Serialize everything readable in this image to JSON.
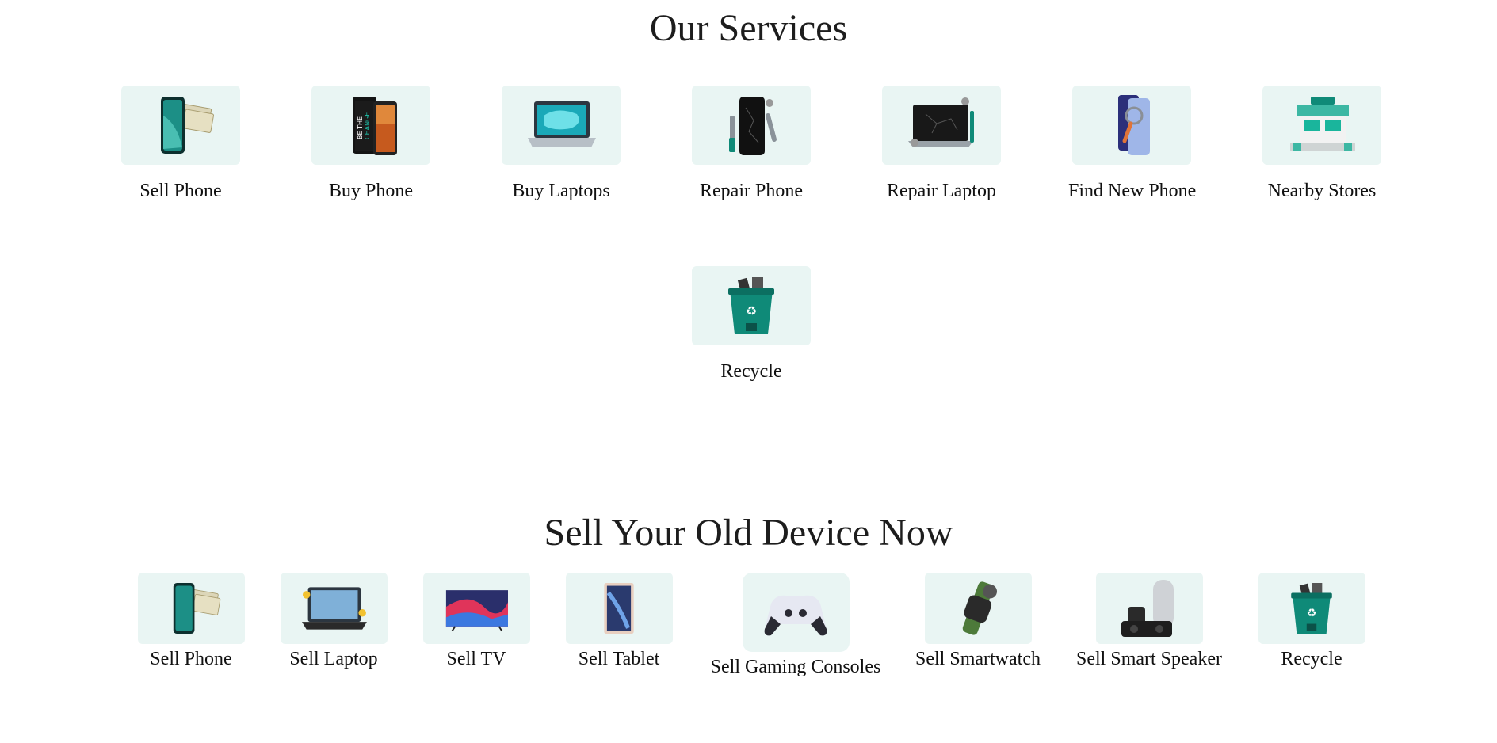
{
  "services": {
    "title": "Our Services",
    "items": [
      {
        "label": "Sell Phone",
        "icon": "phone-cash-icon"
      },
      {
        "label": "Buy Phone",
        "icon": "phones-icon"
      },
      {
        "label": "Buy Laptops",
        "icon": "laptop-icon"
      },
      {
        "label": "Repair Phone",
        "icon": "phone-repair-icon"
      },
      {
        "label": "Repair Laptop",
        "icon": "laptop-repair-icon"
      },
      {
        "label": "Find New Phone",
        "icon": "phone-search-icon"
      },
      {
        "label": "Nearby Stores",
        "icon": "store-icon"
      },
      {
        "label": "Recycle",
        "icon": "recycle-bin-icon"
      }
    ]
  },
  "sell_devices": {
    "title": "Sell Your Old Device Now",
    "items": [
      {
        "label": "Sell Phone",
        "icon": "phone-cash-icon"
      },
      {
        "label": "Sell Laptop",
        "icon": "laptop-icon"
      },
      {
        "label": "Sell TV",
        "icon": "tv-icon"
      },
      {
        "label": "Sell Tablet",
        "icon": "tablet-icon"
      },
      {
        "label": "Sell Gaming Consoles",
        "icon": "gamepad-icon"
      },
      {
        "label": "Sell Smartwatch",
        "icon": "smartwatch-icon"
      },
      {
        "label": "Sell Smart Speaker",
        "icon": "speaker-icon"
      },
      {
        "label": "Recycle",
        "icon": "recycle-bin-icon"
      }
    ]
  },
  "colors": {
    "tile_bg": "#e9f5f3",
    "accent": "#0f8a78",
    "text": "#111111"
  }
}
